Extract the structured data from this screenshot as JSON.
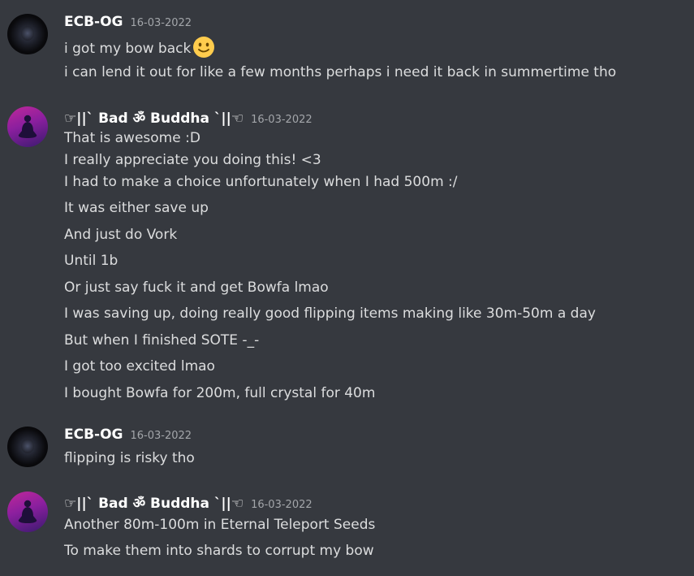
{
  "messages": [
    {
      "author": "ECB-OG",
      "timestamp": "16-03-2022",
      "lines": [
        "i got my bow back",
        "i can lend it out for like a few months perhaps i need it back in summertime tho"
      ],
      "emoji_after_line_0": "slightly-smiling-face-icon"
    },
    {
      "author": "☞||` Bad ॐ Buddha `||☜",
      "timestamp": "16-03-2022",
      "lines": [
        "That is awesome :D",
        "I really appreciate you doing this! <3",
        "I had to make a choice unfortunately when I had 500m :/",
        "It was either save up",
        "And just do Vork",
        "Until 1b",
        "Or just say fuck it and get Bowfa lmao",
        "I was saving up, doing really good flipping items making like 30m-50m a day",
        "But when I finished SOTE -_-",
        "I got too excited lmao",
        "I bought Bowfa for 200m, full crystal for 40m"
      ]
    },
    {
      "author": "ECB-OG",
      "timestamp": "16-03-2022",
      "lines": [
        "flipping is risky tho"
      ]
    },
    {
      "author": "☞||` Bad ॐ Buddha `||☜",
      "timestamp": "16-03-2022",
      "lines": [
        "Another 80m-100m in Eternal Teleport Seeds",
        "To make them into shards to corrupt my bow"
      ]
    }
  ],
  "colors": {
    "background": "#36393f",
    "username": "#ffffff",
    "text": "#dcddde",
    "timestamp": "#a3a6aa"
  }
}
